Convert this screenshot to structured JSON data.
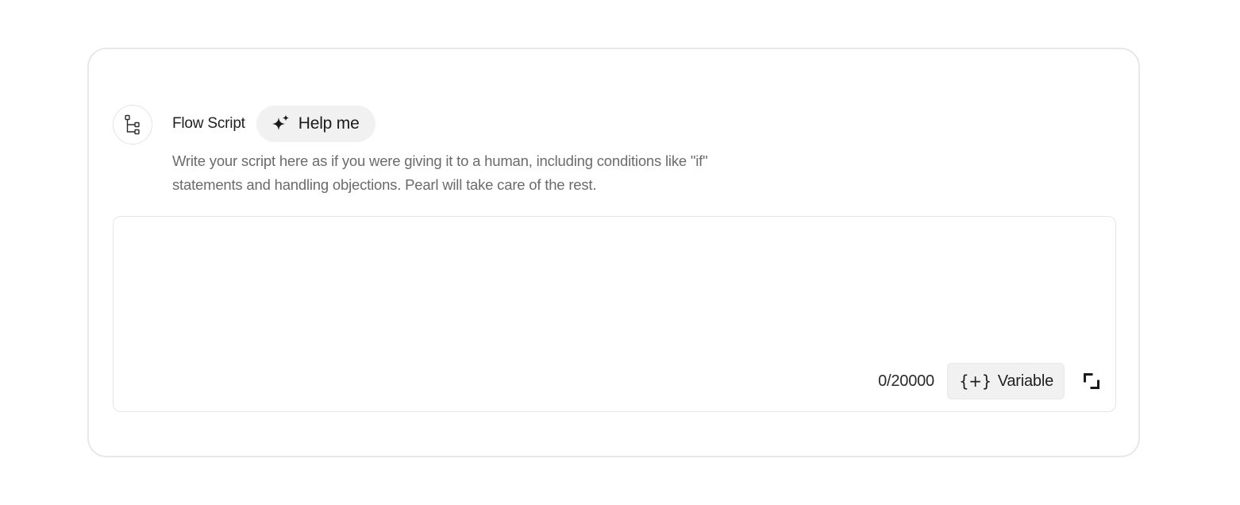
{
  "flow_script": {
    "icon": "flow-tree-icon",
    "title": "Flow Script",
    "help_button": {
      "icon": "sparkle-icon",
      "label": "Help me"
    },
    "description": "Write your script here as if you were giving it to a human, including conditions like \"if\" statements and handling objections. Pearl will take care of the rest."
  },
  "editor": {
    "value": "",
    "placeholder": "",
    "char_count": "0/20000",
    "variable_button": {
      "glyph": "{+}",
      "label": "Variable"
    },
    "expand_icon": "expand-icon"
  },
  "colors": {
    "card_border": "#e8e8e8",
    "button_bg": "#f1f1f1",
    "description_text": "#6b6b6b"
  }
}
